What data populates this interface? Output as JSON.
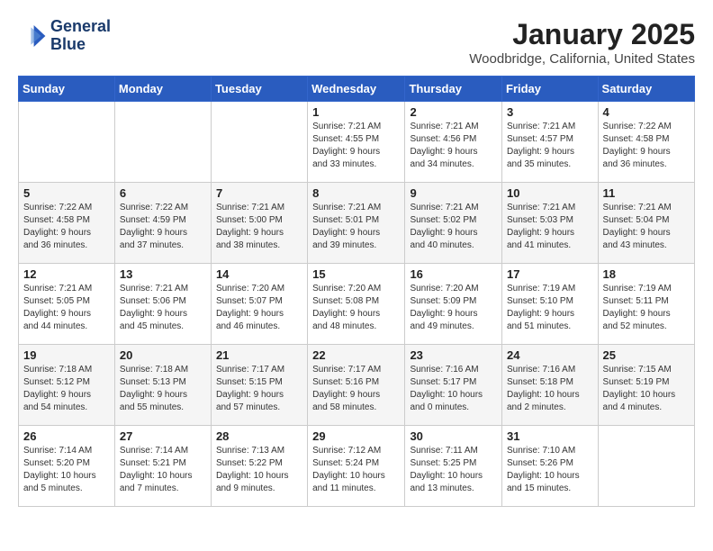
{
  "header": {
    "logo_line1": "General",
    "logo_line2": "Blue",
    "title": "January 2025",
    "subtitle": "Woodbridge, California, United States"
  },
  "weekdays": [
    "Sunday",
    "Monday",
    "Tuesday",
    "Wednesday",
    "Thursday",
    "Friday",
    "Saturday"
  ],
  "weeks": [
    [
      {
        "day": "",
        "info": ""
      },
      {
        "day": "",
        "info": ""
      },
      {
        "day": "",
        "info": ""
      },
      {
        "day": "1",
        "info": "Sunrise: 7:21 AM\nSunset: 4:55 PM\nDaylight: 9 hours\nand 33 minutes."
      },
      {
        "day": "2",
        "info": "Sunrise: 7:21 AM\nSunset: 4:56 PM\nDaylight: 9 hours\nand 34 minutes."
      },
      {
        "day": "3",
        "info": "Sunrise: 7:21 AM\nSunset: 4:57 PM\nDaylight: 9 hours\nand 35 minutes."
      },
      {
        "day": "4",
        "info": "Sunrise: 7:22 AM\nSunset: 4:58 PM\nDaylight: 9 hours\nand 36 minutes."
      }
    ],
    [
      {
        "day": "5",
        "info": "Sunrise: 7:22 AM\nSunset: 4:58 PM\nDaylight: 9 hours\nand 36 minutes."
      },
      {
        "day": "6",
        "info": "Sunrise: 7:22 AM\nSunset: 4:59 PM\nDaylight: 9 hours\nand 37 minutes."
      },
      {
        "day": "7",
        "info": "Sunrise: 7:21 AM\nSunset: 5:00 PM\nDaylight: 9 hours\nand 38 minutes."
      },
      {
        "day": "8",
        "info": "Sunrise: 7:21 AM\nSunset: 5:01 PM\nDaylight: 9 hours\nand 39 minutes."
      },
      {
        "day": "9",
        "info": "Sunrise: 7:21 AM\nSunset: 5:02 PM\nDaylight: 9 hours\nand 40 minutes."
      },
      {
        "day": "10",
        "info": "Sunrise: 7:21 AM\nSunset: 5:03 PM\nDaylight: 9 hours\nand 41 minutes."
      },
      {
        "day": "11",
        "info": "Sunrise: 7:21 AM\nSunset: 5:04 PM\nDaylight: 9 hours\nand 43 minutes."
      }
    ],
    [
      {
        "day": "12",
        "info": "Sunrise: 7:21 AM\nSunset: 5:05 PM\nDaylight: 9 hours\nand 44 minutes."
      },
      {
        "day": "13",
        "info": "Sunrise: 7:21 AM\nSunset: 5:06 PM\nDaylight: 9 hours\nand 45 minutes."
      },
      {
        "day": "14",
        "info": "Sunrise: 7:20 AM\nSunset: 5:07 PM\nDaylight: 9 hours\nand 46 minutes."
      },
      {
        "day": "15",
        "info": "Sunrise: 7:20 AM\nSunset: 5:08 PM\nDaylight: 9 hours\nand 48 minutes."
      },
      {
        "day": "16",
        "info": "Sunrise: 7:20 AM\nSunset: 5:09 PM\nDaylight: 9 hours\nand 49 minutes."
      },
      {
        "day": "17",
        "info": "Sunrise: 7:19 AM\nSunset: 5:10 PM\nDaylight: 9 hours\nand 51 minutes."
      },
      {
        "day": "18",
        "info": "Sunrise: 7:19 AM\nSunset: 5:11 PM\nDaylight: 9 hours\nand 52 minutes."
      }
    ],
    [
      {
        "day": "19",
        "info": "Sunrise: 7:18 AM\nSunset: 5:12 PM\nDaylight: 9 hours\nand 54 minutes."
      },
      {
        "day": "20",
        "info": "Sunrise: 7:18 AM\nSunset: 5:13 PM\nDaylight: 9 hours\nand 55 minutes."
      },
      {
        "day": "21",
        "info": "Sunrise: 7:17 AM\nSunset: 5:15 PM\nDaylight: 9 hours\nand 57 minutes."
      },
      {
        "day": "22",
        "info": "Sunrise: 7:17 AM\nSunset: 5:16 PM\nDaylight: 9 hours\nand 58 minutes."
      },
      {
        "day": "23",
        "info": "Sunrise: 7:16 AM\nSunset: 5:17 PM\nDaylight: 10 hours\nand 0 minutes."
      },
      {
        "day": "24",
        "info": "Sunrise: 7:16 AM\nSunset: 5:18 PM\nDaylight: 10 hours\nand 2 minutes."
      },
      {
        "day": "25",
        "info": "Sunrise: 7:15 AM\nSunset: 5:19 PM\nDaylight: 10 hours\nand 4 minutes."
      }
    ],
    [
      {
        "day": "26",
        "info": "Sunrise: 7:14 AM\nSunset: 5:20 PM\nDaylight: 10 hours\nand 5 minutes."
      },
      {
        "day": "27",
        "info": "Sunrise: 7:14 AM\nSunset: 5:21 PM\nDaylight: 10 hours\nand 7 minutes."
      },
      {
        "day": "28",
        "info": "Sunrise: 7:13 AM\nSunset: 5:22 PM\nDaylight: 10 hours\nand 9 minutes."
      },
      {
        "day": "29",
        "info": "Sunrise: 7:12 AM\nSunset: 5:24 PM\nDaylight: 10 hours\nand 11 minutes."
      },
      {
        "day": "30",
        "info": "Sunrise: 7:11 AM\nSunset: 5:25 PM\nDaylight: 10 hours\nand 13 minutes."
      },
      {
        "day": "31",
        "info": "Sunrise: 7:10 AM\nSunset: 5:26 PM\nDaylight: 10 hours\nand 15 minutes."
      },
      {
        "day": "",
        "info": ""
      }
    ]
  ]
}
